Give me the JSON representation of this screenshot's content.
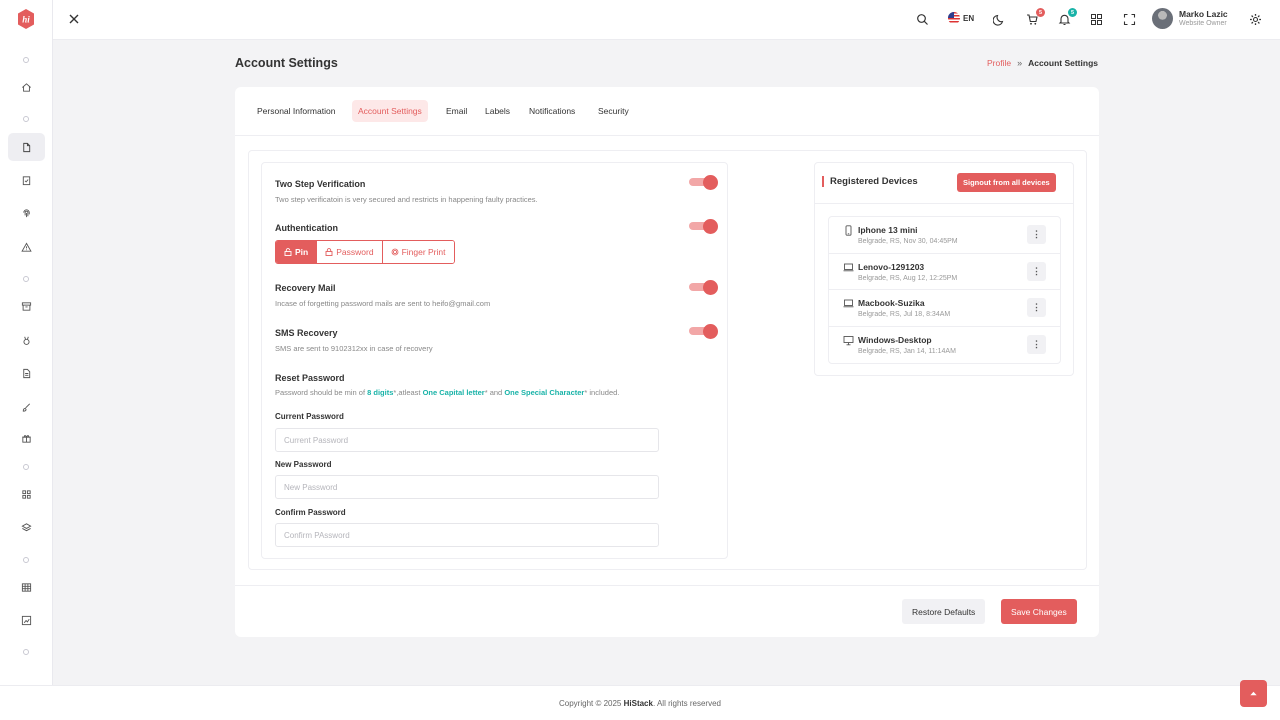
{
  "brand": {
    "logo_text": "hi",
    "accent": "#e35d5d",
    "teal": "#19b3a8"
  },
  "header": {
    "language": "EN",
    "cart_count": "5",
    "notification_count": "5",
    "user_name": "Marko Lazic",
    "user_role": "Website Owner"
  },
  "page": {
    "title": "Account Settings",
    "breadcrumb": {
      "parent": "Profile",
      "separator": "»",
      "current": "Account Settings"
    }
  },
  "tabs": [
    {
      "label": "Personal Information"
    },
    {
      "label": "Account Settings",
      "active": true
    },
    {
      "label": "Email"
    },
    {
      "label": "Labels"
    },
    {
      "label": "Notifications"
    },
    {
      "label": "Security"
    }
  ],
  "settings": {
    "two_step": {
      "title": "Two Step Verification",
      "desc": "Two step verificatoin is very secured and restricts in happening faulty practices.",
      "enabled": true
    },
    "authentication": {
      "title": "Authentication",
      "enabled": true,
      "options": [
        "Pin",
        "Password",
        "Finger Print"
      ],
      "selected": "Pin"
    },
    "recovery_mail": {
      "title": "Recovery Mail",
      "desc": "Incase of forgetting password mails are sent to heifo@gmail.com",
      "enabled": true
    },
    "sms_recovery": {
      "title": "SMS Recovery",
      "desc": "SMS are sent to 9102312xx in case of recovery",
      "enabled": true
    },
    "reset_password": {
      "title": "Reset Password",
      "desc_1": "Password should be min of ",
      "hl_1": "8 digits",
      "desc_2": "*,atleast ",
      "hl_2": "One Capital letter",
      "desc_3": "* and ",
      "hl_3": "One Special Character",
      "desc_4": "* included."
    },
    "current_password": {
      "label": "Current Password",
      "placeholder": "Current Password",
      "value": ""
    },
    "new_password": {
      "label": "New Password",
      "placeholder": "New Password",
      "value": ""
    },
    "confirm_password": {
      "label": "Confirm Password",
      "placeholder": "Confirm PAssword",
      "value": ""
    }
  },
  "devices": {
    "title": "Registered Devices",
    "signout_label": "Signout from all devices",
    "items": [
      {
        "name": "Iphone 13 mini",
        "meta": "Belgrade, RS, Nov 30, 04:45PM",
        "icon": "phone-icon"
      },
      {
        "name": "Lenovo-1291203",
        "meta": "Belgrade, RS, Aug 12, 12:25PM",
        "icon": "laptop-icon"
      },
      {
        "name": "Macbook-Suzika",
        "meta": "Belgrade, RS, Jul 18, 8:34AM",
        "icon": "laptop-icon"
      },
      {
        "name": "Windows-Desktop",
        "meta": "Belgrade, RS, Jan 14, 11:14AM",
        "icon": "desktop-icon"
      }
    ],
    "more_label": "⋮"
  },
  "actions": {
    "restore_label": "Restore Defaults",
    "save_label": "Save Changes"
  },
  "footer": {
    "prefix": "Copyright © 2025 ",
    "brand": "HiStack",
    "suffix": ". All rights reserved"
  }
}
